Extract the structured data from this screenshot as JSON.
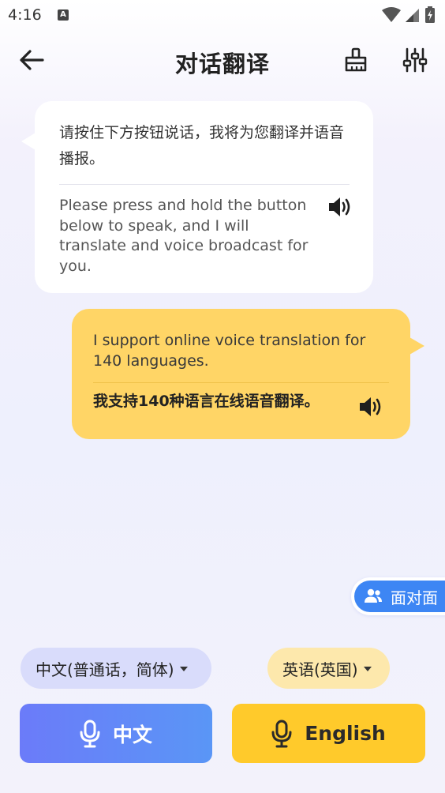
{
  "status_bar": {
    "time": "4:16",
    "notification_icon": "A"
  },
  "app_bar": {
    "title": "对话翻译"
  },
  "messages": [
    {
      "side": "left",
      "source_text": "请按住下方按钮说话，我将为您翻译并语音播报。",
      "translated_text": "Please press and hold the button below to speak, and I will translate and voice broadcast for you."
    },
    {
      "side": "right",
      "source_text": "I support online voice translation for 140 languages.",
      "translated_text": "我支持140种语言在线语音翻译。"
    }
  ],
  "face_to_face": {
    "label": "面对面"
  },
  "languages": {
    "left": "中文(普通话，简体)",
    "right": "英语(英国)"
  },
  "mic_buttons": {
    "left_label": "中文",
    "right_label": "English"
  },
  "colors": {
    "accent_blue": "#3d86f4",
    "bubble_yellow": "#ffd566",
    "button_yellow": "#ffca2b",
    "button_purple": "#6b7bf9"
  }
}
